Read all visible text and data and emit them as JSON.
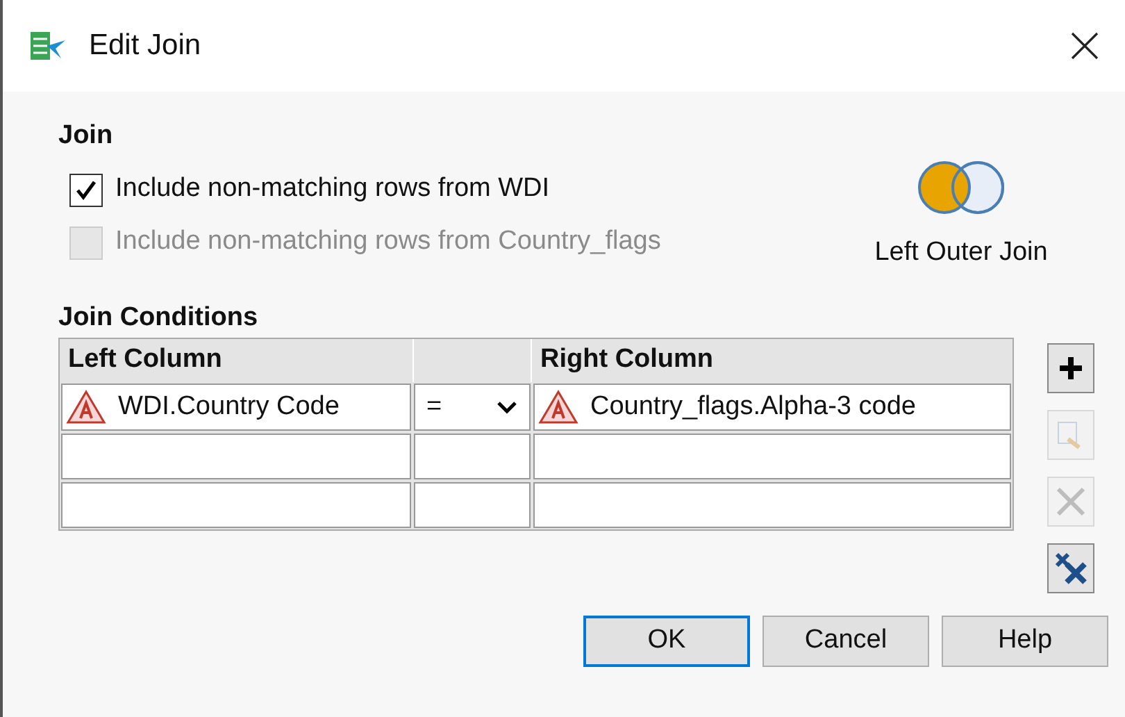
{
  "window": {
    "title": "Edit Join"
  },
  "join": {
    "heading": "Join",
    "options": [
      {
        "label": "Include non-matching rows from WDI",
        "checked": true,
        "disabled": false
      },
      {
        "label": "Include non-matching rows from Country_flags",
        "checked": false,
        "disabled": true
      }
    ],
    "join_type_label": "Left Outer Join"
  },
  "conditions": {
    "heading": "Join Conditions",
    "columns": [
      "Left Column",
      "Right Column"
    ],
    "rows": [
      {
        "kind": "filled",
        "left": "WDI.Country Code",
        "operator": "=",
        "right": "Country_flags.Alpha-3 code"
      },
      {
        "kind": "empty"
      },
      {
        "kind": "empty"
      }
    ],
    "tools": [
      {
        "kind": "add",
        "disabled": false
      },
      {
        "kind": "edit",
        "disabled": true
      },
      {
        "kind": "delete",
        "disabled": true
      },
      {
        "kind": "clear",
        "disabled": false
      }
    ]
  },
  "buttons": [
    {
      "label": "OK",
      "default": true
    },
    {
      "label": "Cancel",
      "default": false
    },
    {
      "label": "Help",
      "default": false
    }
  ]
}
